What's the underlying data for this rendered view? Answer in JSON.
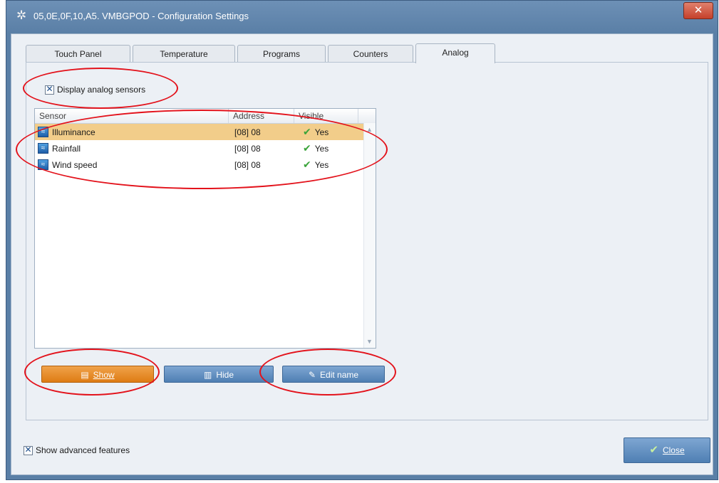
{
  "window": {
    "title": "05,0E,0F,10,A5. VMBGPOD - Configuration Settings",
    "close_glyph": "✕"
  },
  "tabs": [
    {
      "label": "Touch Panel",
      "active": false
    },
    {
      "label": "Temperature",
      "active": false
    },
    {
      "label": "Programs",
      "active": false
    },
    {
      "label": "Counters",
      "active": false
    },
    {
      "label": "Analog",
      "active": true
    }
  ],
  "analog": {
    "display_checkbox_label": "Display analog sensors",
    "display_checked": true,
    "columns": [
      "Sensor",
      "Address",
      "Visible"
    ],
    "rows": [
      {
        "sensor": "Illuminance",
        "address": "[08] 08",
        "visible": "Yes",
        "selected": true
      },
      {
        "sensor": "Rainfall",
        "address": "[08] 08",
        "visible": "Yes",
        "selected": false
      },
      {
        "sensor": "Wind speed",
        "address": "[08] 08",
        "visible": "Yes",
        "selected": false
      }
    ],
    "buttons": {
      "show": "Show",
      "hide": "Hide",
      "edit_name": "Edit name"
    }
  },
  "footer": {
    "advanced_label": "Show advanced features",
    "advanced_checked": true,
    "close_label": "Close"
  },
  "colors": {
    "annotation": "#e3121b",
    "selected_row": "#f2cd8a",
    "show_button": "#de7c14"
  },
  "icons": {
    "title": "gear-icon",
    "sensor": "sensor-icon",
    "visible": "checkmark-icon",
    "show": "show-icon",
    "hide": "hide-icon",
    "edit": "edit-icon",
    "close": "close-check-icon"
  }
}
